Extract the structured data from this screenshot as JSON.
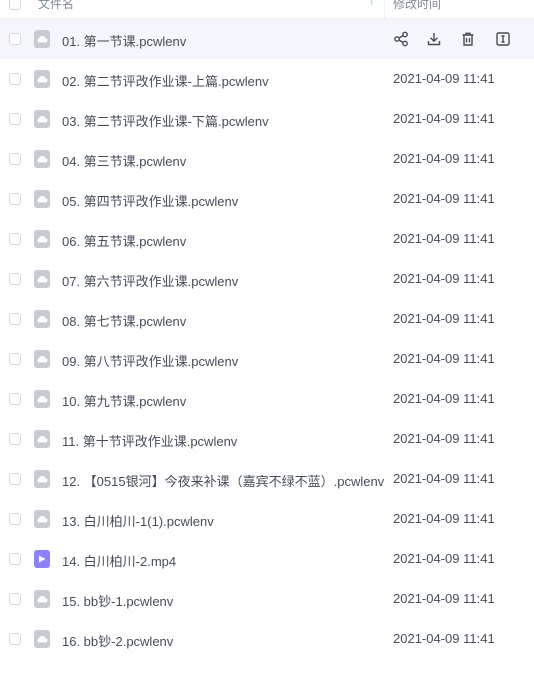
{
  "header": {
    "name_label": "文件名",
    "time_label": "修改时间"
  },
  "files": [
    {
      "name": "01. 第一节课.pcwlenv",
      "time": "",
      "type": "cloud-file-icon",
      "hover": true
    },
    {
      "name": "02. 第二节评改作业课-上篇.pcwlenv",
      "time": "2021-04-09 11:41",
      "type": "cloud-file-icon"
    },
    {
      "name": "03. 第二节评改作业课-下篇.pcwlenv",
      "time": "2021-04-09 11:41",
      "type": "cloud-file-icon"
    },
    {
      "name": "04. 第三节课.pcwlenv",
      "time": "2021-04-09 11:41",
      "type": "cloud-file-icon"
    },
    {
      "name": "05. 第四节评改作业课.pcwlenv",
      "time": "2021-04-09 11:41",
      "type": "cloud-file-icon"
    },
    {
      "name": "06. 第五节课.pcwlenv",
      "time": "2021-04-09 11:41",
      "type": "cloud-file-icon"
    },
    {
      "name": "07. 第六节评改作业课.pcwlenv",
      "time": "2021-04-09 11:41",
      "type": "cloud-file-icon"
    },
    {
      "name": "08. 第七节课.pcwlenv",
      "time": "2021-04-09 11:41",
      "type": "cloud-file-icon"
    },
    {
      "name": "09. 第八节评改作业课.pcwlenv",
      "time": "2021-04-09 11:41",
      "type": "cloud-file-icon"
    },
    {
      "name": "10. 第九节课.pcwlenv",
      "time": "2021-04-09 11:41",
      "type": "cloud-file-icon"
    },
    {
      "name": "11. 第十节评改作业课.pcwlenv",
      "time": "2021-04-09 11:41",
      "type": "cloud-file-icon"
    },
    {
      "name": "12. 【0515银河】今夜来补课（嘉宾不绿不蓝）.pcwlenv",
      "time": "2021-04-09 11:41",
      "type": "cloud-file-icon"
    },
    {
      "name": "13. 白川柏川-1(1).pcwlenv",
      "time": "2021-04-09 11:41",
      "type": "cloud-file-icon"
    },
    {
      "name": "14. 白川柏川-2.mp4",
      "time": "2021-04-09 11:41",
      "type": "video-file-icon"
    },
    {
      "name": "15. bb钞-1.pcwlenv",
      "time": "2021-04-09 11:41",
      "type": "cloud-file-icon"
    },
    {
      "name": "16. bb钞-2.pcwlenv",
      "time": "2021-04-09 11:41",
      "type": "cloud-file-icon"
    }
  ],
  "row_actions": [
    "share-icon",
    "download-icon",
    "delete-icon",
    "rename-icon"
  ],
  "colors": {
    "accent": "#06a7ff",
    "hover_bg": "#f4f6fb",
    "file_icon": "#c7cbd3",
    "video_icon": "#8c82ff"
  }
}
